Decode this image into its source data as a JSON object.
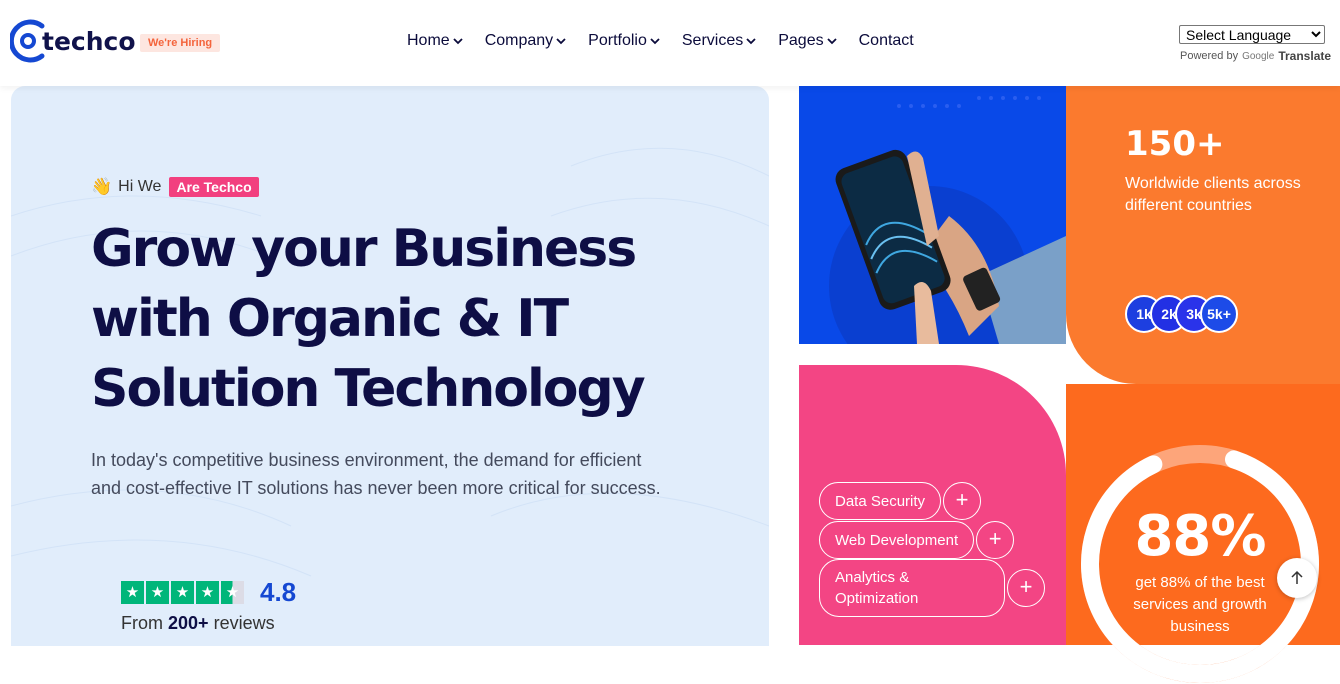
{
  "header": {
    "logo_text": "techco",
    "hiring_badge": "We're Hiring",
    "nav": [
      {
        "label": "Home",
        "has_dropdown": true
      },
      {
        "label": "Company",
        "has_dropdown": true
      },
      {
        "label": "Portfolio",
        "has_dropdown": true
      },
      {
        "label": "Services",
        "has_dropdown": true
      },
      {
        "label": "Pages",
        "has_dropdown": true
      },
      {
        "label": "Contact",
        "has_dropdown": false
      }
    ],
    "language_select": "Select Language",
    "powered_by": "Powered by",
    "google": "Google",
    "translate": "Translate"
  },
  "hero": {
    "greeting": "Hi We",
    "tag": "Are Techco",
    "headline_line1": "Grow your Business",
    "headline_line2": "with Organic & IT",
    "headline_line3": "Solution Technology",
    "description": "In today's competitive business environment, the demand for efficient and cost-effective IT solutions has never been more critical for success.",
    "rating_value": "4.8",
    "rating_stars": 4.5,
    "reviews_prefix": "From",
    "reviews_count": "200+",
    "reviews_suffix": "reviews"
  },
  "stats_card": {
    "number": "150+",
    "text": "Worldwide clients across different countries",
    "bubbles": [
      "1k",
      "2k",
      "3k",
      "5k+"
    ]
  },
  "services_card": {
    "items": [
      "Data Security",
      "Web Development",
      "Analytics &",
      "Optimization"
    ]
  },
  "progress_card": {
    "percent_label": "88%",
    "percent_value": 88,
    "text": "get 88% of the best services and growth business"
  },
  "colors": {
    "navy": "#0e0e45",
    "blue": "#0949e8",
    "orange": "#fb7a2e",
    "pink": "#f34584",
    "deep_orange": "#fd6a1e",
    "star_green": "#00b67a"
  },
  "icons": [
    "logo-icon",
    "chevron-down-icon",
    "wave-hand-icon",
    "star-icon",
    "plus-icon",
    "arrow-up-icon"
  ]
}
